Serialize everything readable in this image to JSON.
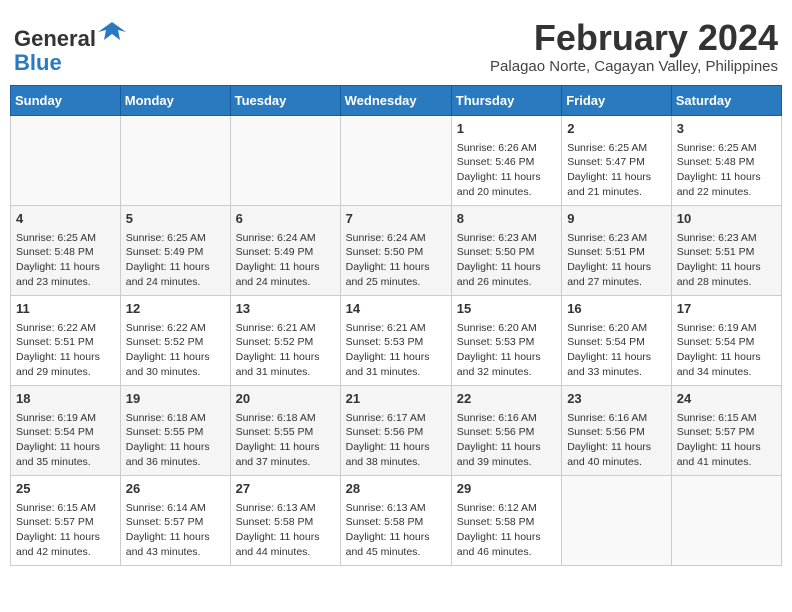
{
  "header": {
    "logo_line1": "General",
    "logo_line2": "Blue",
    "month_title": "February 2024",
    "subtitle": "Palagao Norte, Cagayan Valley, Philippines"
  },
  "days_header": [
    "Sunday",
    "Monday",
    "Tuesday",
    "Wednesday",
    "Thursday",
    "Friday",
    "Saturday"
  ],
  "weeks": [
    [
      {
        "day": "",
        "content": ""
      },
      {
        "day": "",
        "content": ""
      },
      {
        "day": "",
        "content": ""
      },
      {
        "day": "",
        "content": ""
      },
      {
        "day": "1",
        "content": "Sunrise: 6:26 AM\nSunset: 5:46 PM\nDaylight: 11 hours and 20 minutes."
      },
      {
        "day": "2",
        "content": "Sunrise: 6:25 AM\nSunset: 5:47 PM\nDaylight: 11 hours and 21 minutes."
      },
      {
        "day": "3",
        "content": "Sunrise: 6:25 AM\nSunset: 5:48 PM\nDaylight: 11 hours and 22 minutes."
      }
    ],
    [
      {
        "day": "4",
        "content": "Sunrise: 6:25 AM\nSunset: 5:48 PM\nDaylight: 11 hours and 23 minutes."
      },
      {
        "day": "5",
        "content": "Sunrise: 6:25 AM\nSunset: 5:49 PM\nDaylight: 11 hours and 24 minutes."
      },
      {
        "day": "6",
        "content": "Sunrise: 6:24 AM\nSunset: 5:49 PM\nDaylight: 11 hours and 24 minutes."
      },
      {
        "day": "7",
        "content": "Sunrise: 6:24 AM\nSunset: 5:50 PM\nDaylight: 11 hours and 25 minutes."
      },
      {
        "day": "8",
        "content": "Sunrise: 6:23 AM\nSunset: 5:50 PM\nDaylight: 11 hours and 26 minutes."
      },
      {
        "day": "9",
        "content": "Sunrise: 6:23 AM\nSunset: 5:51 PM\nDaylight: 11 hours and 27 minutes."
      },
      {
        "day": "10",
        "content": "Sunrise: 6:23 AM\nSunset: 5:51 PM\nDaylight: 11 hours and 28 minutes."
      }
    ],
    [
      {
        "day": "11",
        "content": "Sunrise: 6:22 AM\nSunset: 5:51 PM\nDaylight: 11 hours and 29 minutes."
      },
      {
        "day": "12",
        "content": "Sunrise: 6:22 AM\nSunset: 5:52 PM\nDaylight: 11 hours and 30 minutes."
      },
      {
        "day": "13",
        "content": "Sunrise: 6:21 AM\nSunset: 5:52 PM\nDaylight: 11 hours and 31 minutes."
      },
      {
        "day": "14",
        "content": "Sunrise: 6:21 AM\nSunset: 5:53 PM\nDaylight: 11 hours and 31 minutes."
      },
      {
        "day": "15",
        "content": "Sunrise: 6:20 AM\nSunset: 5:53 PM\nDaylight: 11 hours and 32 minutes."
      },
      {
        "day": "16",
        "content": "Sunrise: 6:20 AM\nSunset: 5:54 PM\nDaylight: 11 hours and 33 minutes."
      },
      {
        "day": "17",
        "content": "Sunrise: 6:19 AM\nSunset: 5:54 PM\nDaylight: 11 hours and 34 minutes."
      }
    ],
    [
      {
        "day": "18",
        "content": "Sunrise: 6:19 AM\nSunset: 5:54 PM\nDaylight: 11 hours and 35 minutes."
      },
      {
        "day": "19",
        "content": "Sunrise: 6:18 AM\nSunset: 5:55 PM\nDaylight: 11 hours and 36 minutes."
      },
      {
        "day": "20",
        "content": "Sunrise: 6:18 AM\nSunset: 5:55 PM\nDaylight: 11 hours and 37 minutes."
      },
      {
        "day": "21",
        "content": "Sunrise: 6:17 AM\nSunset: 5:56 PM\nDaylight: 11 hours and 38 minutes."
      },
      {
        "day": "22",
        "content": "Sunrise: 6:16 AM\nSunset: 5:56 PM\nDaylight: 11 hours and 39 minutes."
      },
      {
        "day": "23",
        "content": "Sunrise: 6:16 AM\nSunset: 5:56 PM\nDaylight: 11 hours and 40 minutes."
      },
      {
        "day": "24",
        "content": "Sunrise: 6:15 AM\nSunset: 5:57 PM\nDaylight: 11 hours and 41 minutes."
      }
    ],
    [
      {
        "day": "25",
        "content": "Sunrise: 6:15 AM\nSunset: 5:57 PM\nDaylight: 11 hours and 42 minutes."
      },
      {
        "day": "26",
        "content": "Sunrise: 6:14 AM\nSunset: 5:57 PM\nDaylight: 11 hours and 43 minutes."
      },
      {
        "day": "27",
        "content": "Sunrise: 6:13 AM\nSunset: 5:58 PM\nDaylight: 11 hours and 44 minutes."
      },
      {
        "day": "28",
        "content": "Sunrise: 6:13 AM\nSunset: 5:58 PM\nDaylight: 11 hours and 45 minutes."
      },
      {
        "day": "29",
        "content": "Sunrise: 6:12 AM\nSunset: 5:58 PM\nDaylight: 11 hours and 46 minutes."
      },
      {
        "day": "",
        "content": ""
      },
      {
        "day": "",
        "content": ""
      }
    ]
  ]
}
